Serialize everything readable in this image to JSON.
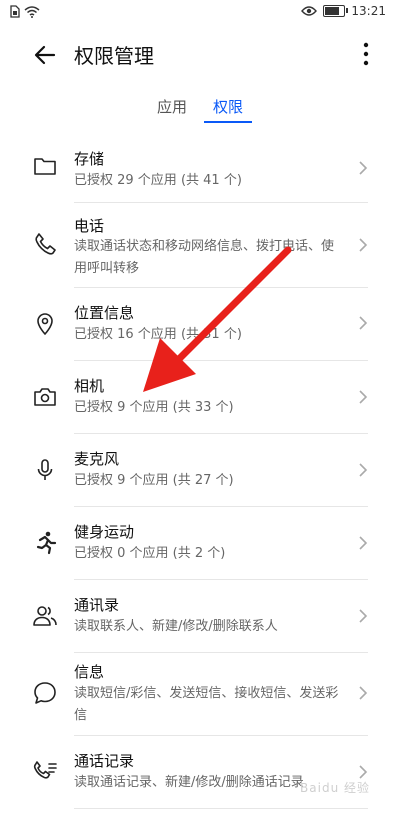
{
  "status_bar": {
    "time": "13:21",
    "battery_level": 0.7
  },
  "header": {
    "title": "权限管理"
  },
  "tabs": [
    {
      "label": "应用",
      "selected": false
    },
    {
      "label": "权限",
      "selected": true
    }
  ],
  "permissions": [
    {
      "name": "存储",
      "desc": "已授权 29 个应用 (共 41 个)",
      "icon": "folder-icon"
    },
    {
      "name": "电话",
      "desc": "读取通话状态和移动网络信息、拨打电话、使用呼叫转移",
      "icon": "phone-icon"
    },
    {
      "name": "位置信息",
      "desc": "已授权 16 个应用 (共 31 个)",
      "icon": "location-pin-icon"
    },
    {
      "name": "相机",
      "desc": "已授权 9 个应用 (共 33 个)",
      "icon": "camera-icon"
    },
    {
      "name": "麦克风",
      "desc": "已授权 9 个应用 (共 27 个)",
      "icon": "microphone-icon"
    },
    {
      "name": "健身运动",
      "desc": "已授权 0 个应用 (共 2 个)",
      "icon": "running-person-icon"
    },
    {
      "name": "通讯录",
      "desc": "读取联系人、新建/修改/删除联系人",
      "icon": "contacts-icon"
    },
    {
      "name": "信息",
      "desc": "读取短信/彩信、发送短信、接收短信、发送彩信",
      "icon": "message-bubble-icon"
    },
    {
      "name": "通话记录",
      "desc": "读取通话记录、新建/修改/删除通话记录",
      "icon": "call-log-icon"
    }
  ],
  "colors": {
    "accent": "#0a59f7",
    "arrow": "#e8211b"
  },
  "watermark": "Baidu 经验"
}
